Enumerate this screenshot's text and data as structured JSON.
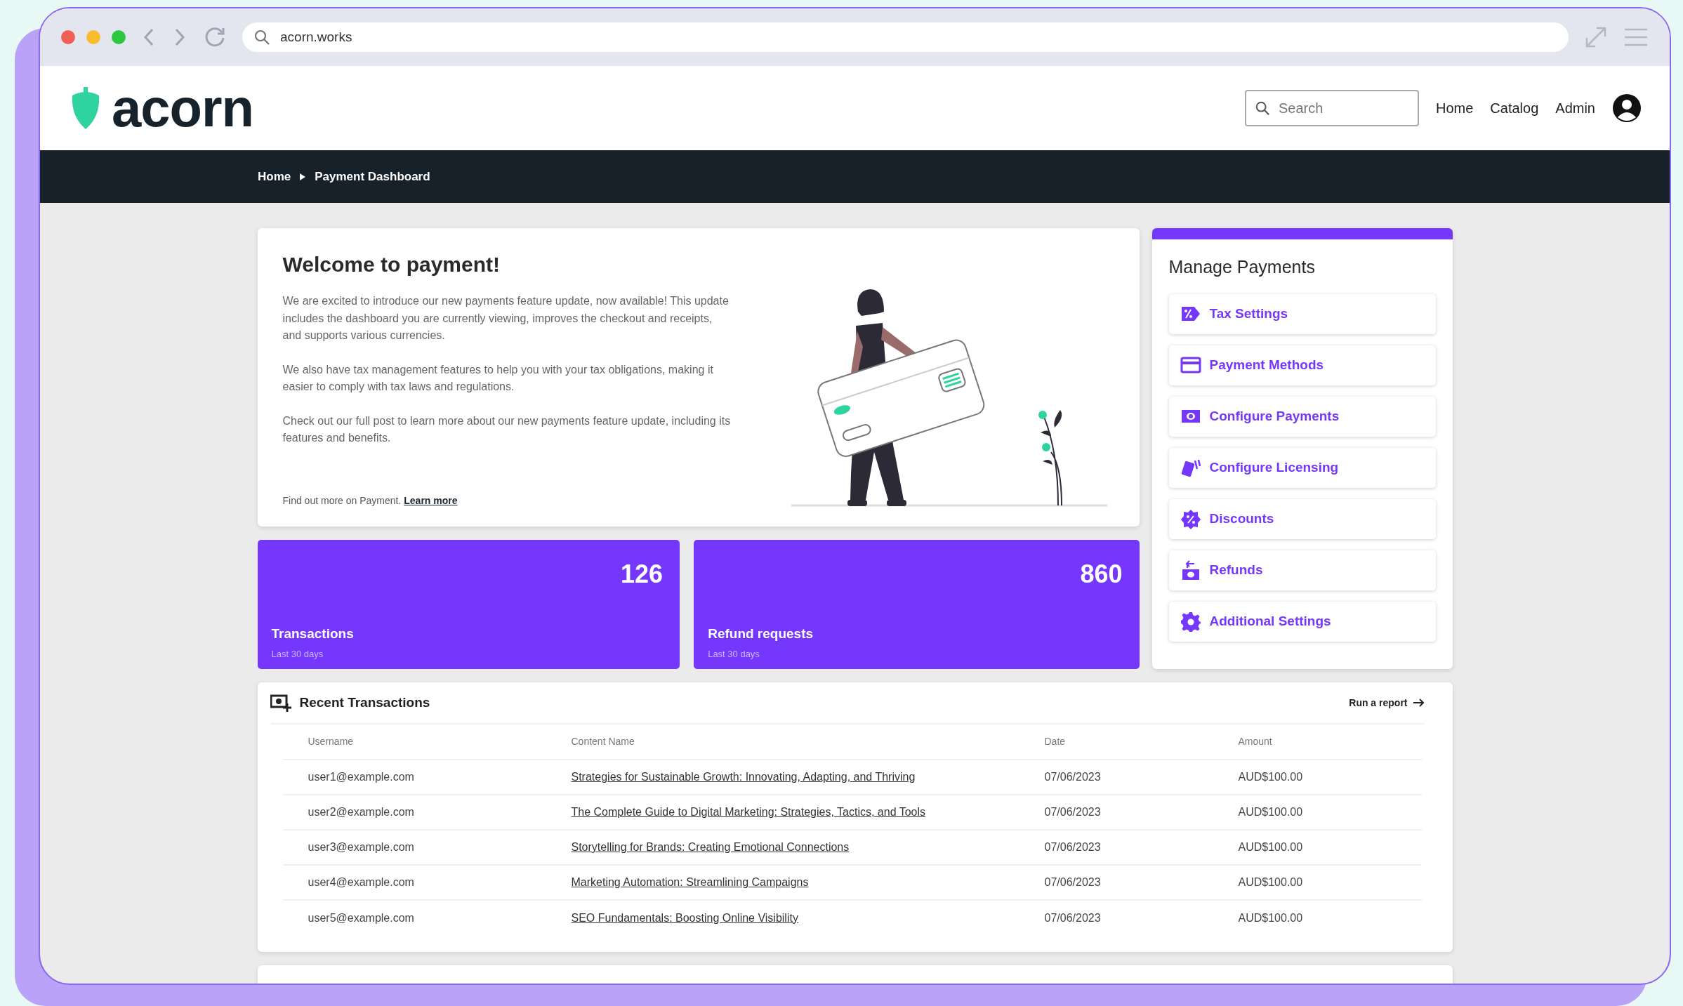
{
  "browser": {
    "url": "acorn.works"
  },
  "header": {
    "logo_text": "acorn",
    "search": {
      "placeholder": "Search"
    },
    "nav": [
      "Home",
      "Catalog",
      "Admin"
    ]
  },
  "breadcrumb": [
    "Home",
    "Payment Dashboard"
  ],
  "welcome": {
    "title": "Welcome to payment!",
    "paragraphs": [
      "We are excited to introduce our new payments feature update, now available! This update includes the dashboard you are currently viewing, improves the checkout and receipts, and supports various currencies.",
      "We also have tax management features to help you with your tax obligations, making it easier to comply with tax laws and regulations.",
      "Check out our full post to learn more about our new payments feature update, including its features and benefits."
    ],
    "footer_text": "Find out more on Payment.",
    "link": "Learn more"
  },
  "stats": [
    {
      "value": "126",
      "label": "Transactions",
      "sub": "Last 30 days"
    },
    {
      "value": "860",
      "label": "Refund requests",
      "sub": "Last 30 days"
    }
  ],
  "manage": {
    "title": "Manage Payments",
    "items": [
      {
        "label": "Tax Settings",
        "kind": "tag"
      },
      {
        "label": "Payment Methods",
        "kind": "card"
      },
      {
        "label": "Configure Payments",
        "kind": "cash"
      },
      {
        "label": "Configure Licensing",
        "kind": "cards"
      },
      {
        "label": "Discounts",
        "kind": "badge"
      },
      {
        "label": "Refunds",
        "kind": "refund"
      },
      {
        "label": "Additional Settings",
        "kind": "gear"
      }
    ]
  },
  "recent_transactions": {
    "title": "Recent Transactions",
    "action": "Run a report",
    "columns": [
      "Username",
      "Content Name",
      "Date",
      "Amount"
    ],
    "rows": [
      [
        "user1@example.com",
        "Strategies for Sustainable Growth: Innovating, Adapting, and Thriving",
        "07/06/2023",
        "AUD$100.00"
      ],
      [
        "user2@example.com",
        "The Complete Guide to Digital Marketing: Strategies, Tactics, and Tools",
        "07/06/2023",
        "AUD$100.00"
      ],
      [
        "user3@example.com",
        "Storytelling for Brands: Creating Emotional Connections",
        "07/06/2023",
        "AUD$100.00"
      ],
      [
        "user4@example.com",
        "Marketing Automation: Streamlining Campaigns",
        "07/06/2023",
        "AUD$100.00"
      ],
      [
        "user5@example.com",
        "SEO Fundamentals: Boosting Online Visibility",
        "07/06/2023",
        "AUD$100.00"
      ]
    ]
  }
}
